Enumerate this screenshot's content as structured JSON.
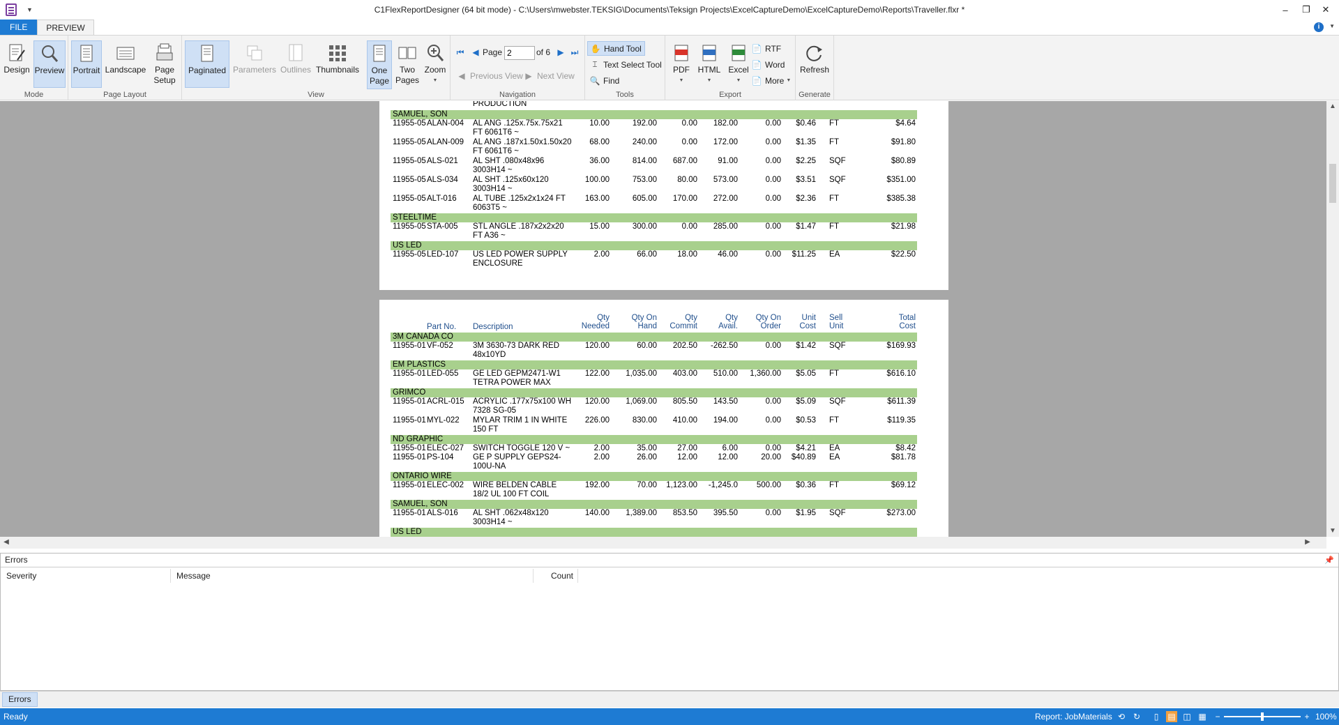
{
  "window": {
    "title": "C1FlexReportDesigner (64 bit mode) - C:\\Users\\mwebster.TEKSIG\\Documents\\Teksign Projects\\ExcelCaptureDemo\\ExcelCaptureDemo\\Reports\\Traveller.flxr *",
    "minimize": "–",
    "restore": "❐",
    "close": "✕"
  },
  "ribbon_tabs": {
    "file": "FILE",
    "preview": "PREVIEW"
  },
  "ribbon": {
    "mode": {
      "label": "Mode",
      "design": "Design",
      "preview": "Preview"
    },
    "page_layout": {
      "label": "Page Layout",
      "portrait": "Portrait",
      "landscape": "Landscape",
      "page_setup_1": "Page",
      "page_setup_2": "Setup"
    },
    "view": {
      "label": "View",
      "paginated": "Paginated",
      "parameters": "Parameters",
      "outlines": "Outlines",
      "thumbnails": "Thumbnails",
      "one_page_1": "One",
      "one_page_2": "Page",
      "two_pages_1": "Two",
      "two_pages_2": "Pages",
      "zoom": "Zoom"
    },
    "navigation": {
      "label": "Navigation",
      "page_label": "Page",
      "page_value": "2",
      "page_of": "of 6",
      "previous_view": "Previous View",
      "next_view": "Next View"
    },
    "tools": {
      "label": "Tools",
      "hand_tool": "Hand Tool",
      "text_select_tool": "Text Select Tool",
      "find": "Find"
    },
    "export": {
      "label": "Export",
      "pdf": "PDF",
      "html": "HTML",
      "excel": "Excel",
      "rtf": "RTF",
      "word": "Word",
      "more": "More"
    },
    "generate": {
      "label": "Generate",
      "refresh": "Refresh"
    }
  },
  "report": {
    "page1": {
      "top_text": "PRODUCTION",
      "groups": [
        {
          "vendor": "SAMUEL, SON",
          "rows": [
            {
              "job": "11955-05",
              "part": "ALAN-004",
              "desc": "AL ANG .125x.75x.75x21 FT 6061T6 ~",
              "needed": "10.00",
              "onhand": "192.00",
              "commit": "0.00",
              "avail": "182.00",
              "onorder": "0.00",
              "unit": "$0.46",
              "sell": "FT",
              "total": "$4.64"
            },
            {
              "job": "11955-05",
              "part": "ALAN-009",
              "desc": "AL ANG .187x1.50x1.50x20 FT 6061T6 ~",
              "needed": "68.00",
              "onhand": "240.00",
              "commit": "0.00",
              "avail": "172.00",
              "onorder": "0.00",
              "unit": "$1.35",
              "sell": "FT",
              "total": "$91.80"
            },
            {
              "job": "11955-05",
              "part": "ALS-021",
              "desc": "AL SHT .080x48x96 3003H14 ~",
              "needed": "36.00",
              "onhand": "814.00",
              "commit": "687.00",
              "avail": "91.00",
              "onorder": "0.00",
              "unit": "$2.25",
              "sell": "SQF",
              "total": "$80.89"
            },
            {
              "job": "11955-05",
              "part": "ALS-034",
              "desc": "AL SHT .125x60x120 3003H14 ~",
              "needed": "100.00",
              "onhand": "753.00",
              "commit": "80.00",
              "avail": "573.00",
              "onorder": "0.00",
              "unit": "$3.51",
              "sell": "SQF",
              "total": "$351.00"
            },
            {
              "job": "11955-05",
              "part": "ALT-016",
              "desc": "AL TUBE .125x2x1x24 FT 6063T5 ~",
              "needed": "163.00",
              "onhand": "605.00",
              "commit": "170.00",
              "avail": "272.00",
              "onorder": "0.00",
              "unit": "$2.36",
              "sell": "FT",
              "total": "$385.38"
            }
          ]
        },
        {
          "vendor": "STEELTIME",
          "rows": [
            {
              "job": "11955-05",
              "part": "STA-005",
              "desc": "STL ANGLE .187x2x2x20 FT A36 ~",
              "needed": "15.00",
              "onhand": "300.00",
              "commit": "0.00",
              "avail": "285.00",
              "onorder": "0.00",
              "unit": "$1.47",
              "sell": "FT",
              "total": "$21.98"
            }
          ]
        },
        {
          "vendor": "US LED",
          "rows": [
            {
              "job": "11955-05",
              "part": "LED-107",
              "desc": "US LED POWER SUPPLY ENCLOSURE",
              "needed": "2.00",
              "onhand": "66.00",
              "commit": "18.00",
              "avail": "46.00",
              "onorder": "0.00",
              "unit": "$11.25",
              "sell": "EA",
              "total": "$22.50"
            }
          ]
        }
      ]
    },
    "page2": {
      "headers": {
        "part": "Part No.",
        "desc": "Description",
        "needed_1": "Qty",
        "needed_2": "Needed",
        "onhand_1": "Qty On",
        "onhand_2": "Hand",
        "commit_1": "Qty",
        "commit_2": "Commit",
        "avail_1": "Qty",
        "avail_2": "Avail.",
        "onorder_1": "Qty On",
        "onorder_2": "Order",
        "unit_1": "Unit",
        "unit_2": "Cost",
        "sell_1": "Sell",
        "sell_2": "Unit",
        "total_1": "Total",
        "total_2": "Cost"
      },
      "groups": [
        {
          "vendor": "3M CANADA CO",
          "rows": [
            {
              "job": "11955-01",
              "part": "VF-052",
              "desc": "3M 3630-73 DARK RED 48x10YD",
              "needed": "120.00",
              "onhand": "60.00",
              "commit": "202.50",
              "avail": "-262.50",
              "onorder": "0.00",
              "unit": "$1.42",
              "sell": "SQF",
              "total": "$169.93"
            }
          ]
        },
        {
          "vendor": "EM PLASTICS",
          "rows": [
            {
              "job": "11955-01",
              "part": "LED-055",
              "desc": "GE LED GEPM2471-W1 TETRA POWER MAX",
              "needed": "122.00",
              "onhand": "1,035.00",
              "commit": "403.00",
              "avail": "510.00",
              "onorder": "1,360.00",
              "unit": "$5.05",
              "sell": "FT",
              "total": "$616.10"
            }
          ]
        },
        {
          "vendor": "GRIMCO",
          "rows": [
            {
              "job": "11955-01",
              "part": "ACRL-015",
              "desc": "ACRYLIC .177x75x100 WH 7328 SG-05",
              "needed": "120.00",
              "onhand": "1,069.00",
              "commit": "805.50",
              "avail": "143.50",
              "onorder": "0.00",
              "unit": "$5.09",
              "sell": "SQF",
              "total": "$611.39"
            },
            {
              "job": "11955-01",
              "part": "MYL-022",
              "desc": "MYLAR TRIM 1 IN WHITE 150 FT",
              "needed": "226.00",
              "onhand": "830.00",
              "commit": "410.00",
              "avail": "194.00",
              "onorder": "0.00",
              "unit": "$0.53",
              "sell": "FT",
              "total": "$119.35"
            }
          ]
        },
        {
          "vendor": "ND GRAPHIC",
          "rows": [
            {
              "job": "11955-01",
              "part": "ELEC-027",
              "desc": "SWITCH TOGGLE 120 V ~",
              "needed": "2.00",
              "onhand": "35.00",
              "commit": "27.00",
              "avail": "6.00",
              "onorder": "0.00",
              "unit": "$4.21",
              "sell": "EA",
              "total": "$8.42"
            },
            {
              "job": "11955-01",
              "part": "PS-104",
              "desc": "GE P SUPPLY GEPS24-100U-NA",
              "needed": "2.00",
              "onhand": "26.00",
              "commit": "12.00",
              "avail": "12.00",
              "onorder": "20.00",
              "unit": "$40.89",
              "sell": "EA",
              "total": "$81.78"
            }
          ]
        },
        {
          "vendor": "ONTARIO WIRE",
          "rows": [
            {
              "job": "11955-01",
              "part": "ELEC-002",
              "desc": "WIRE BELDEN CABLE 18/2 UL 100 FT COIL",
              "needed": "192.00",
              "onhand": "70.00",
              "commit": "1,123.00",
              "avail": "-1,245.0",
              "onorder": "500.00",
              "unit": "$0.36",
              "sell": "FT",
              "total": "$69.12"
            }
          ]
        },
        {
          "vendor": "SAMUEL, SON",
          "rows": [
            {
              "job": "11955-01",
              "part": "ALS-016",
              "desc": "AL SHT .062x48x120 3003H14 ~",
              "needed": "140.00",
              "onhand": "1,389.00",
              "commit": "853.50",
              "avail": "395.50",
              "onorder": "0.00",
              "unit": "$1.95",
              "sell": "SQF",
              "total": "$273.00"
            }
          ]
        },
        {
          "vendor": "US LED",
          "rows": []
        }
      ]
    }
  },
  "errors_panel": {
    "title": "Errors",
    "pin": "📌",
    "columns": {
      "severity": "Severity",
      "message": "Message",
      "count": "Count"
    },
    "tab": "Errors"
  },
  "statusbar": {
    "status": "Ready",
    "report": "Report: JobMaterials",
    "zoom": "100%",
    "zoom_fraction": 0.5
  },
  "colors": {
    "accent": "#1e7bd3",
    "group_band": "#a8d08d",
    "header_text": "#1f4e8c",
    "canvas": "#a7a7a7"
  }
}
